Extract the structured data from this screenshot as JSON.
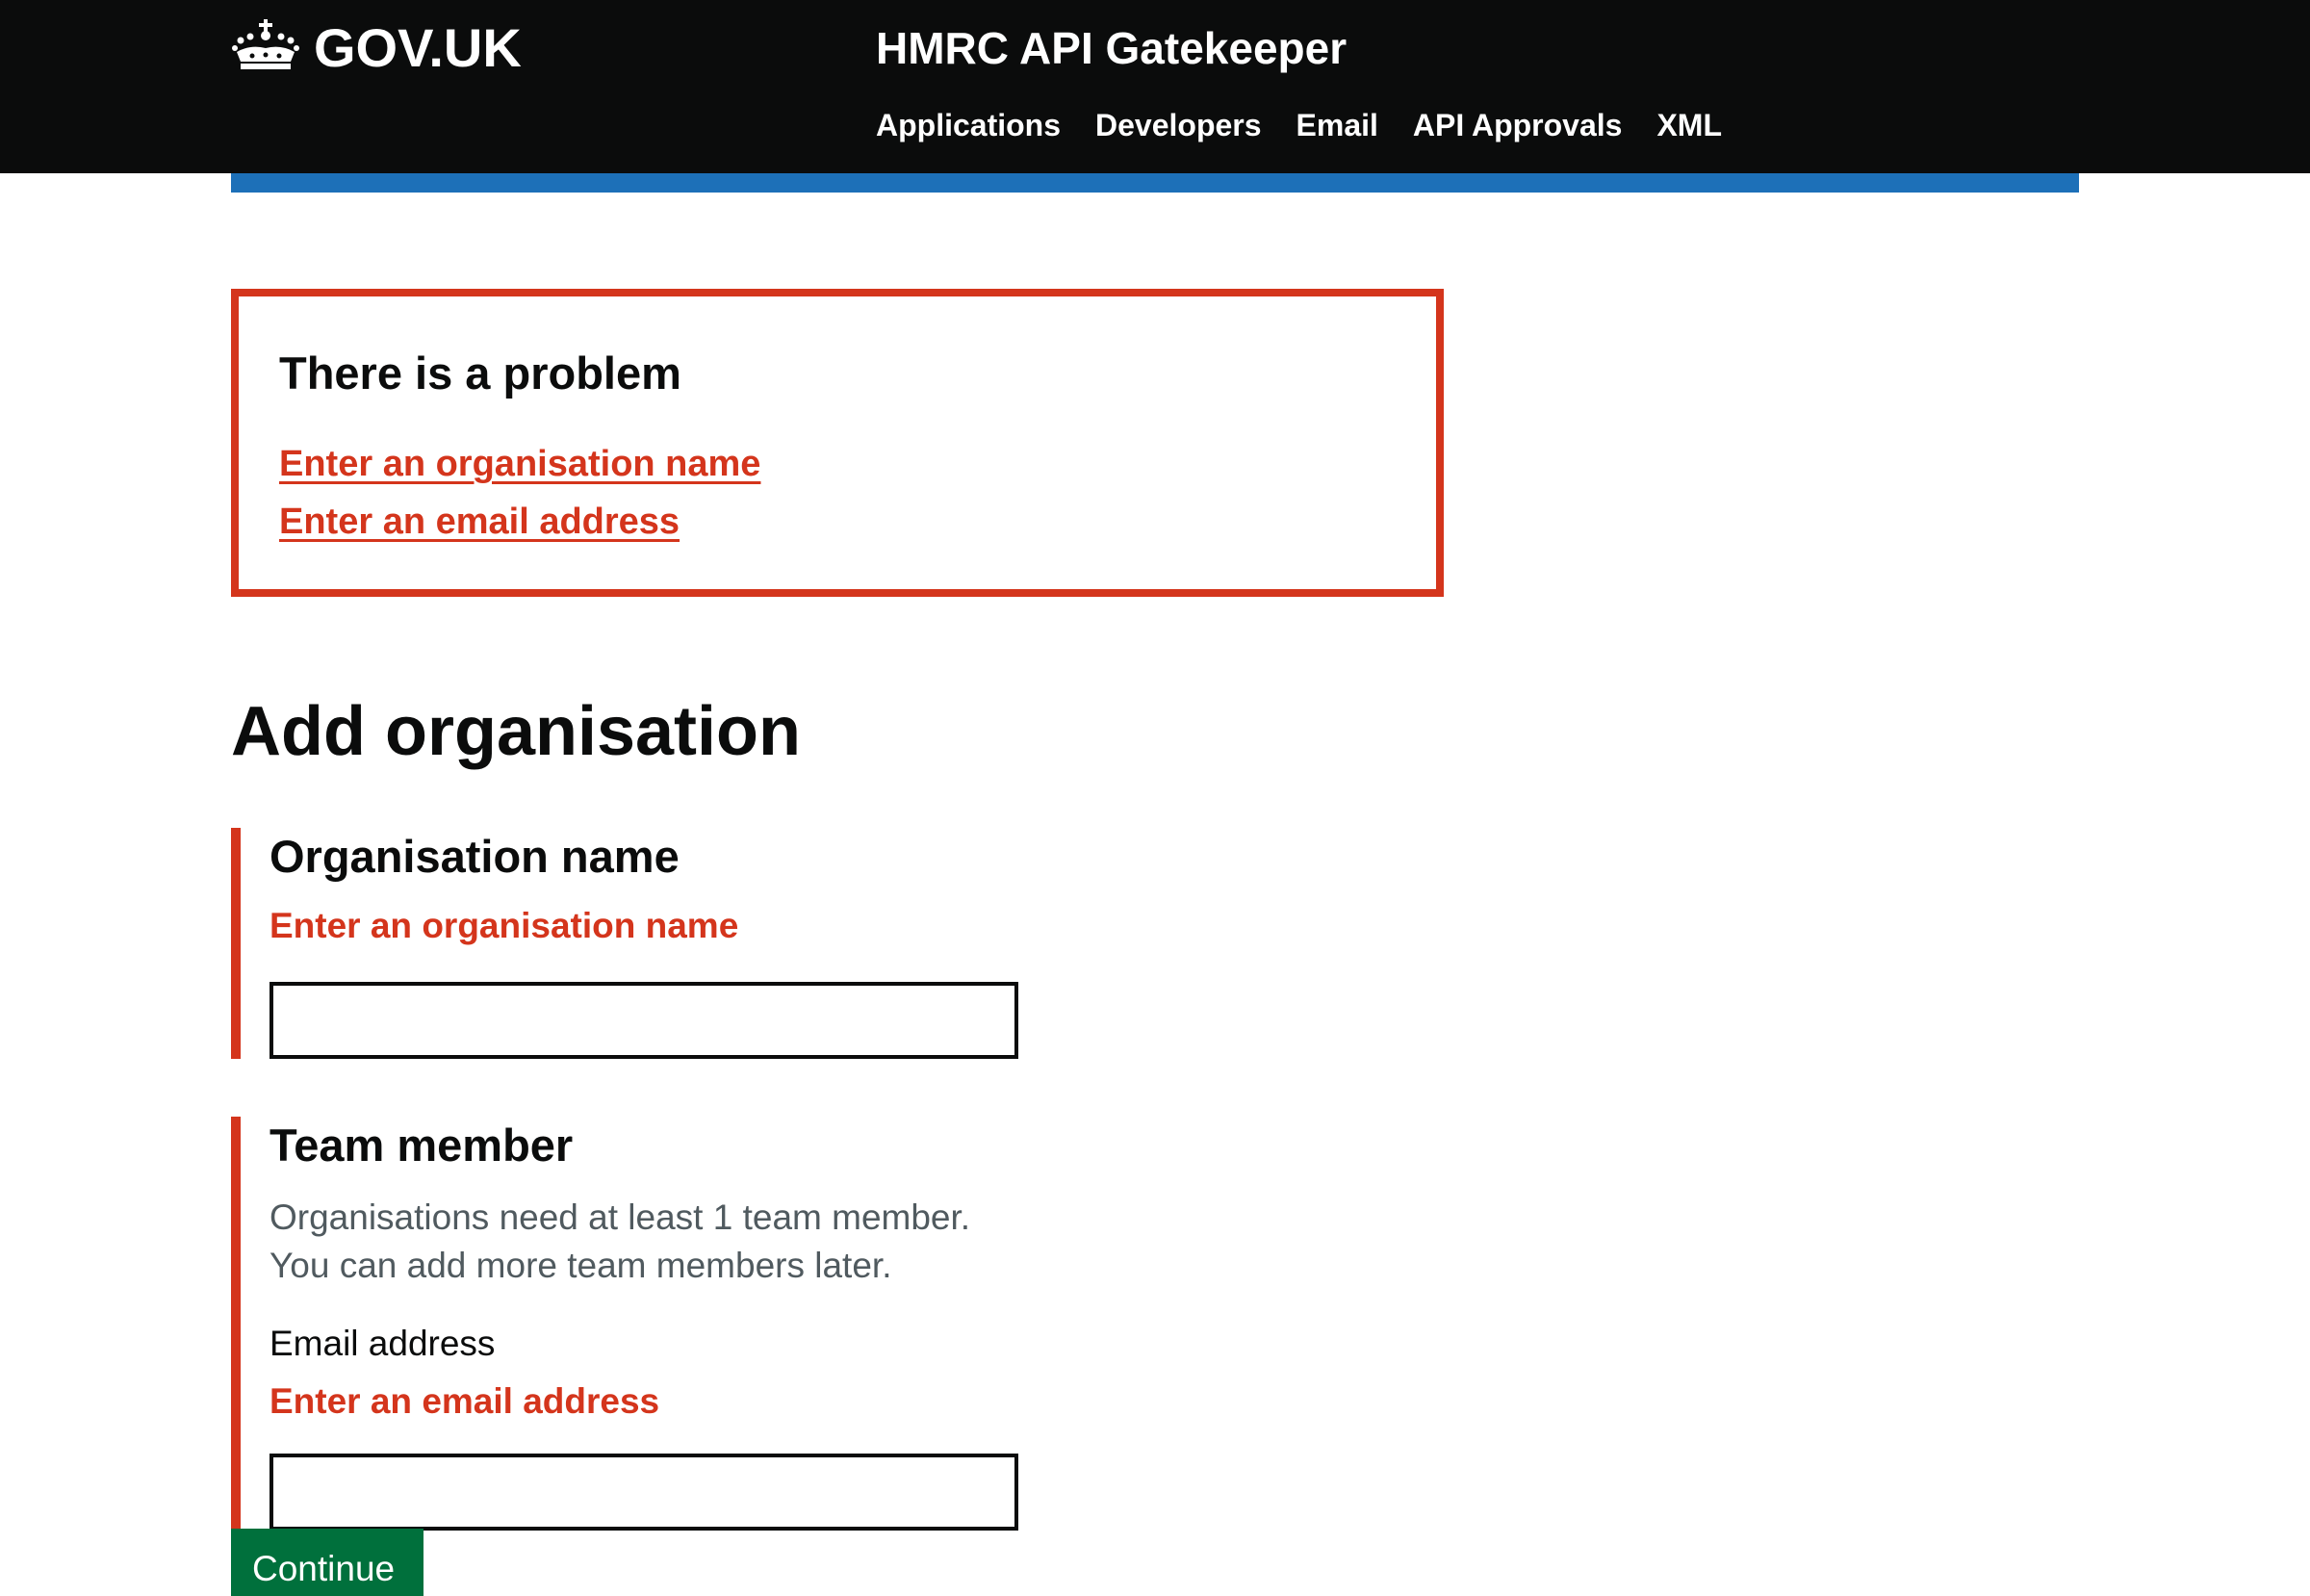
{
  "header": {
    "logo_text": "GOV.UK",
    "logo_icon": "crown-icon",
    "service_name": "HMRC API Gatekeeper",
    "nav": [
      {
        "label": "Applications"
      },
      {
        "label": "Developers"
      },
      {
        "label": "Email"
      },
      {
        "label": "API Approvals"
      },
      {
        "label": "XML"
      }
    ]
  },
  "error_summary": {
    "title": "There is a problem",
    "errors": [
      {
        "label": "Enter an organisation name"
      },
      {
        "label": "Enter an email address"
      }
    ]
  },
  "page": {
    "title": "Add organisation"
  },
  "organisation_name": {
    "heading": "Organisation name",
    "error": "Enter an organisation name",
    "value": ""
  },
  "team_member": {
    "heading": "Team member",
    "hint_line1": "Organisations need at least 1 team member.",
    "hint_line2": "You can add more team members later.",
    "email_label": "Email address",
    "email_error": "Enter an email address",
    "email_value": ""
  },
  "actions": {
    "continue_label": "Continue"
  },
  "colors": {
    "header_bg": "#0b0c0c",
    "brand_blue": "#1d70b8",
    "error_red": "#d4351c",
    "hint_grey": "#505a5f",
    "button_green": "#00703c"
  }
}
